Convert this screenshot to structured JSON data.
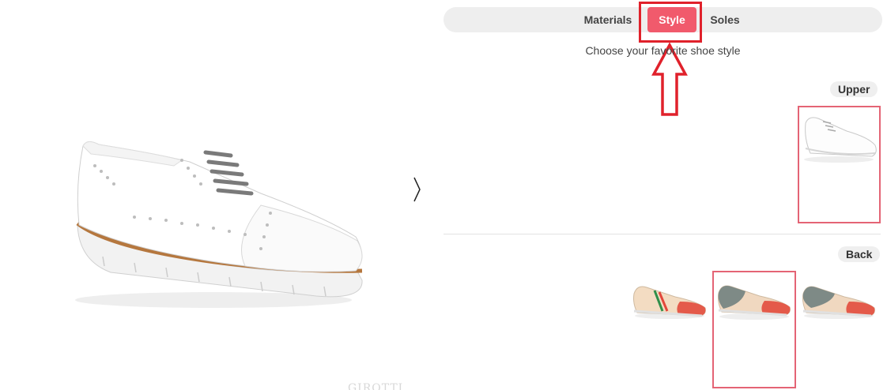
{
  "tabs": {
    "materials": "Materials",
    "style": "Style",
    "soles": "Soles",
    "active": "Style"
  },
  "subtitle": "Choose your favorite shoe style",
  "sections": {
    "upper": {
      "label": "Upper"
    },
    "back": {
      "label": "Back"
    }
  },
  "preview": {
    "watermark": "GIROTTI"
  },
  "colors": {
    "accent": "#f15a6c",
    "annotation": "#e0212b",
    "selected_border": "#e46475",
    "tab_bg": "#eeeeee"
  }
}
